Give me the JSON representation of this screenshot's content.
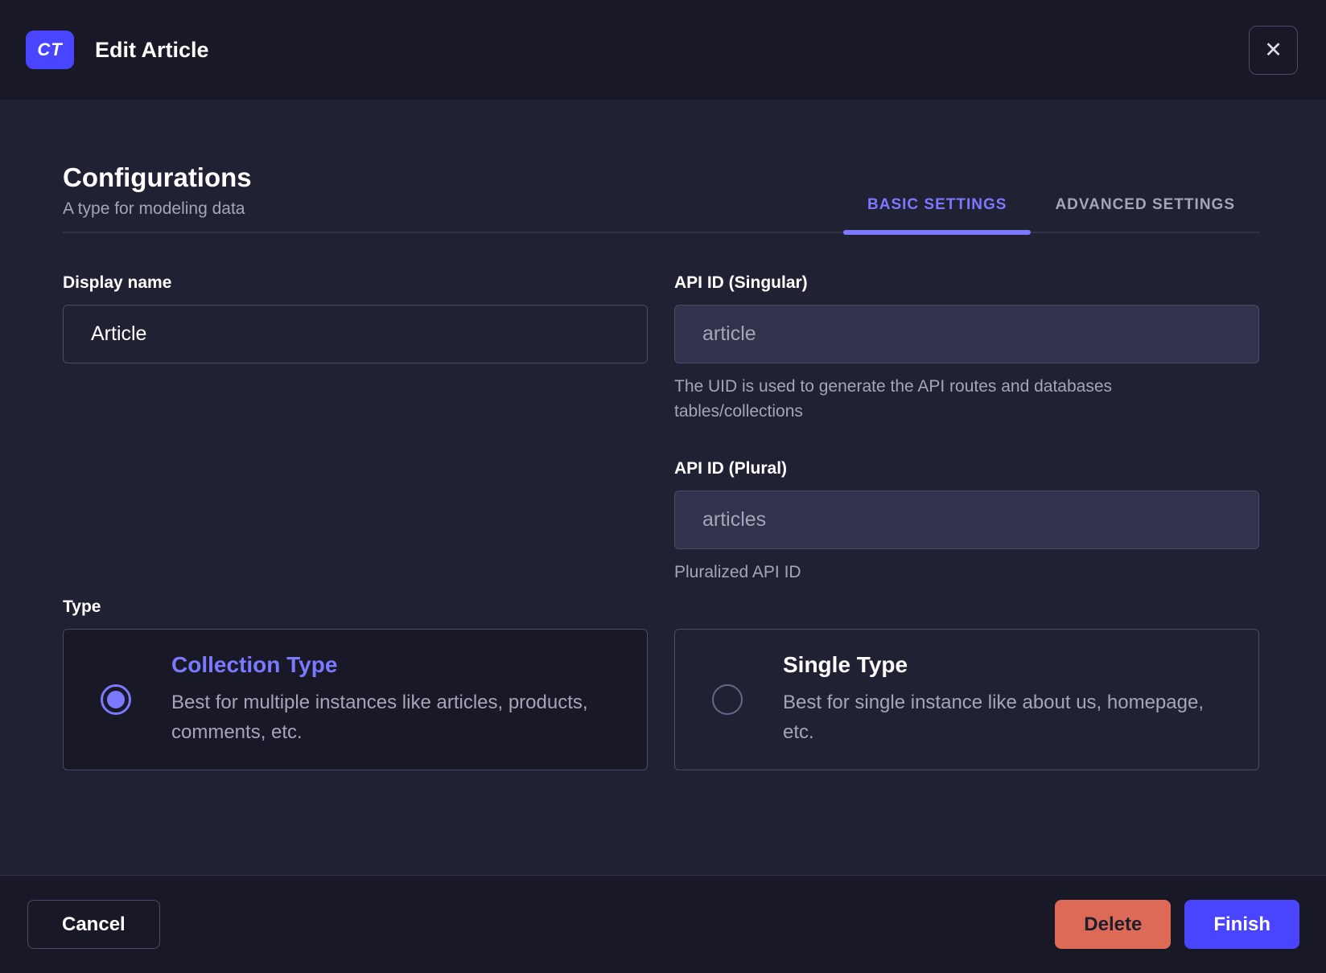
{
  "modal": {
    "header": {
      "badge": "CT",
      "title": "Edit Article",
      "close_icon": "✕"
    },
    "section": {
      "title": "Configurations",
      "subtitle": "A type for modeling data"
    },
    "tabs": [
      {
        "label": "BASIC SETTINGS",
        "active": true
      },
      {
        "label": "ADVANCED SETTINGS",
        "active": false
      }
    ],
    "fields": {
      "display_name": {
        "label": "Display name",
        "value": "Article"
      },
      "api_id_singular": {
        "label": "API ID (Singular)",
        "value": "article",
        "disabled": true,
        "hint": "The UID is used to generate the API routes and databases tables/collections"
      },
      "api_id_plural": {
        "label": "API ID (Plural)",
        "value": "articles",
        "disabled": true,
        "hint": "Pluralized API ID"
      }
    },
    "type_field": {
      "label": "Type",
      "options": [
        {
          "title": "Collection Type",
          "description": "Best for multiple instances like articles, products, comments, etc.",
          "selected": true
        },
        {
          "title": "Single Type",
          "description": "Best for single instance like about us, homepage, etc.",
          "selected": false
        }
      ]
    },
    "footer": {
      "cancel_label": "Cancel",
      "delete_label": "Delete",
      "finish_label": "Finish"
    },
    "colors": {
      "accent": "#7b79ff",
      "primary": "#4945ff",
      "danger": "#dd6a56",
      "header_bg": "#181826",
      "body_bg": "#212134"
    }
  }
}
